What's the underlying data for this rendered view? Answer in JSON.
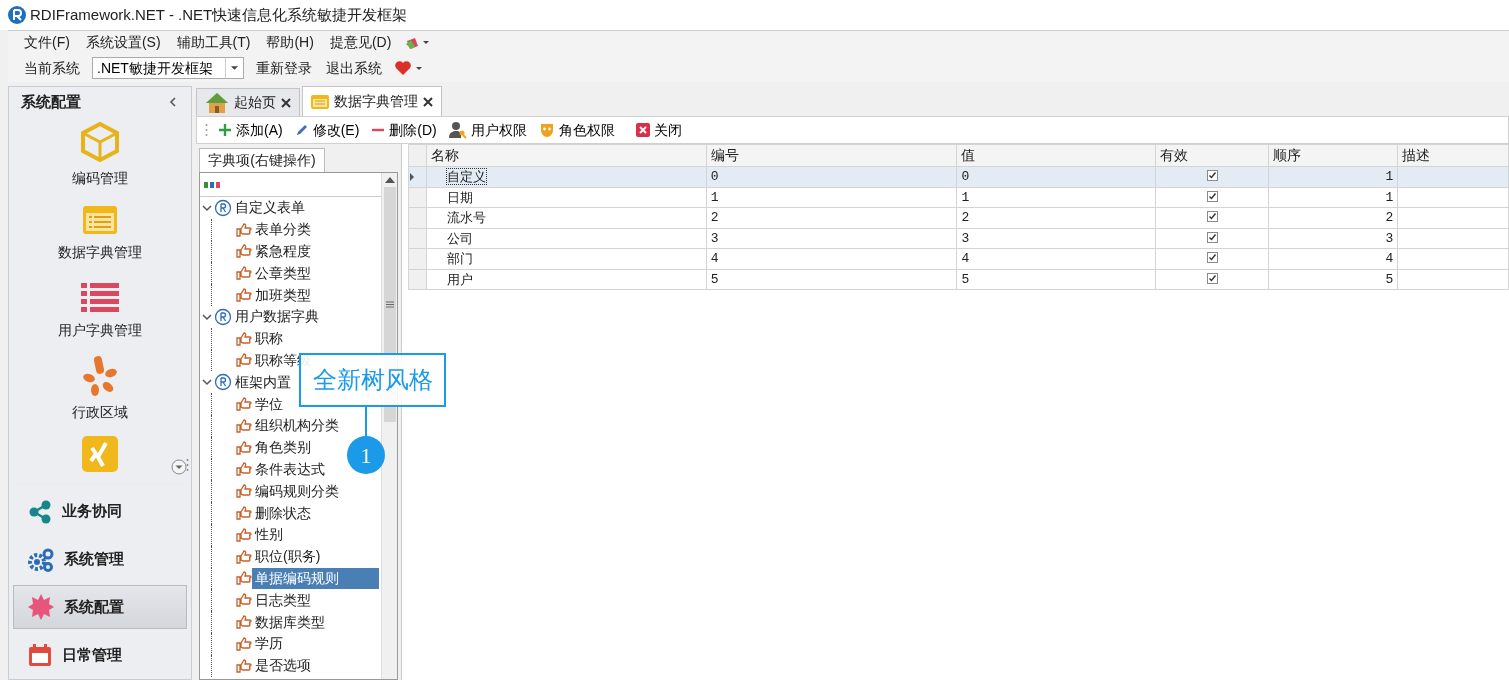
{
  "window": {
    "title": "RDIFramework.NET - .NET快速信息化系统敏捷开发框架"
  },
  "menu": [
    {
      "label": "文件(F)"
    },
    {
      "label": "系统设置(S)"
    },
    {
      "label": "辅助工具(T)"
    },
    {
      "label": "帮助(H)"
    },
    {
      "label": "提意见(D)"
    }
  ],
  "system_bar": {
    "label": "当前系统",
    "system_select": {
      "value": ".NET敏捷开发框架"
    },
    "buttons": [
      "重新登录",
      "退出系统"
    ]
  },
  "sidebar": {
    "title": "系统配置",
    "tiles": [
      {
        "kind": "cube",
        "label": "编码管理"
      },
      {
        "kind": "dict",
        "label": "数据字典管理"
      },
      {
        "kind": "list",
        "label": "用户字典管理"
      },
      {
        "kind": "petals",
        "label": "行政区域"
      },
      {
        "kind": "xing"
      }
    ],
    "nav": [
      {
        "kind": "share",
        "label": "业务协同",
        "selected": false
      },
      {
        "kind": "gears",
        "label": "系统管理",
        "selected": false
      },
      {
        "kind": "burst",
        "label": "系统配置",
        "selected": true
      },
      {
        "kind": "calendar",
        "label": "日常管理",
        "selected": false
      }
    ]
  },
  "tabs": [
    {
      "kind": "home",
      "label": "起始页",
      "selected": false
    },
    {
      "kind": "dict",
      "label": "数据字典管理",
      "selected": true
    }
  ],
  "actions": [
    {
      "kind": "add",
      "label": "添加(A)"
    },
    {
      "kind": "edit",
      "label": "修改(E)"
    },
    {
      "kind": "delete",
      "label": "删除(D)"
    },
    {
      "kind": "user",
      "label": "用户权限"
    },
    {
      "kind": "role",
      "label": "角色权限"
    },
    {
      "kind": "close",
      "label": "关闭"
    }
  ],
  "tree_panel": {
    "tab": "字典项(右键操作)",
    "tree": [
      {
        "label": "自定义表单",
        "expanded": true,
        "selected": false,
        "children": [
          {
            "label": "表单分类",
            "selected": false
          },
          {
            "label": "紧急程度",
            "selected": false
          },
          {
            "label": "公章类型",
            "selected": false
          },
          {
            "label": "加班类型",
            "selected": false
          }
        ]
      },
      {
        "label": "用户数据字典",
        "expanded": true,
        "selected": false,
        "children": [
          {
            "label": "职称",
            "selected": false
          },
          {
            "label": "职称等级",
            "selected": false
          }
        ]
      },
      {
        "label": "框架内置",
        "expanded": true,
        "selected": false,
        "children": [
          {
            "label": "学位",
            "selected": false
          },
          {
            "label": "组织机构分类",
            "selected": false
          },
          {
            "label": "角色类别",
            "selected": false
          },
          {
            "label": "条件表达式",
            "selected": false
          },
          {
            "label": "编码规则分类",
            "selected": false
          },
          {
            "label": "删除状态",
            "selected": false
          },
          {
            "label": "性别",
            "selected": false
          },
          {
            "label": "职位(职务)",
            "selected": false
          },
          {
            "label": "单据编码规则",
            "selected": true
          },
          {
            "label": "日志类型",
            "selected": false
          },
          {
            "label": "数据库类型",
            "selected": false
          },
          {
            "label": "学历",
            "selected": false
          },
          {
            "label": "是否选项",
            "selected": false
          }
        ]
      }
    ]
  },
  "callout": {
    "text": "全新树风格",
    "number": "1"
  },
  "grid": {
    "columns": [
      "名称",
      "编号",
      "值",
      "有效",
      "顺序",
      "描述"
    ],
    "rows": [
      {
        "name": "自定义",
        "code": "0",
        "value": "0",
        "valid": true,
        "order": "1",
        "selected": true
      },
      {
        "name": "日期",
        "code": "1",
        "value": "1",
        "valid": true,
        "order": "1",
        "selected": false
      },
      {
        "name": "流水号",
        "code": "2",
        "value": "2",
        "valid": true,
        "order": "2",
        "selected": false
      },
      {
        "name": "公司",
        "code": "3",
        "value": "3",
        "valid": true,
        "order": "3",
        "selected": false
      },
      {
        "name": "部门",
        "code": "4",
        "value": "4",
        "valid": true,
        "order": "4",
        "selected": false
      },
      {
        "name": "用户",
        "code": "5",
        "value": "5",
        "valid": true,
        "order": "5",
        "selected": false
      }
    ]
  }
}
